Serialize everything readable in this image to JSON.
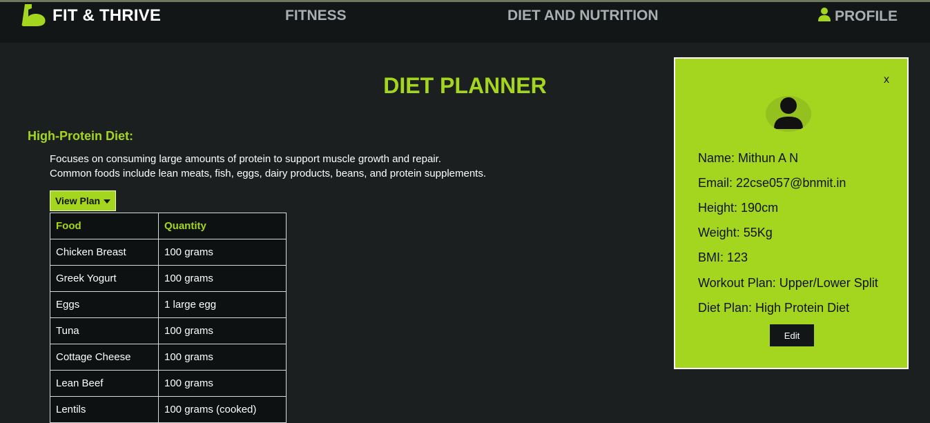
{
  "nav": {
    "brand": "FIT & THRIVE",
    "fitness": "FITNESS",
    "diet": "DIET AND NUTRITION",
    "profile": "PROFILE"
  },
  "page": {
    "title": "DIET PLANNER",
    "section_title": "High-Protein Diet:",
    "desc_line1": "Focuses on consuming large amounts of protein to support muscle growth and repair.",
    "desc_line2": "Common foods include lean meats, fish, eggs, dairy products, beans, and protein supplements.",
    "view_plan": "View Plan"
  },
  "table": {
    "headers": [
      "Food",
      "Quantity"
    ],
    "rows": [
      [
        "Chicken Breast",
        "100 grams"
      ],
      [
        "Greek Yogurt",
        "100 grams"
      ],
      [
        "Eggs",
        "1 large egg"
      ],
      [
        "Tuna",
        "100 grams"
      ],
      [
        "Cottage Cheese",
        "100 grams"
      ],
      [
        "Lean Beef",
        "100 grams"
      ],
      [
        "Lentils",
        "100 grams (cooked)"
      ]
    ]
  },
  "profile": {
    "close": "x",
    "name": "Name: Mithun A N",
    "email": "Email: 22cse057@bnmit.in",
    "height": "Height: 190cm",
    "weight": "Weight: 55Kg",
    "bmi": "BMI: 123",
    "workout": "Workout Plan: Upper/Lower Split",
    "diet": "Diet Plan: High Protein Diet",
    "edit": "Edit"
  },
  "colors": {
    "accent": "#a4d61f",
    "background": "#1b1f1f",
    "navbar": "#121616"
  }
}
